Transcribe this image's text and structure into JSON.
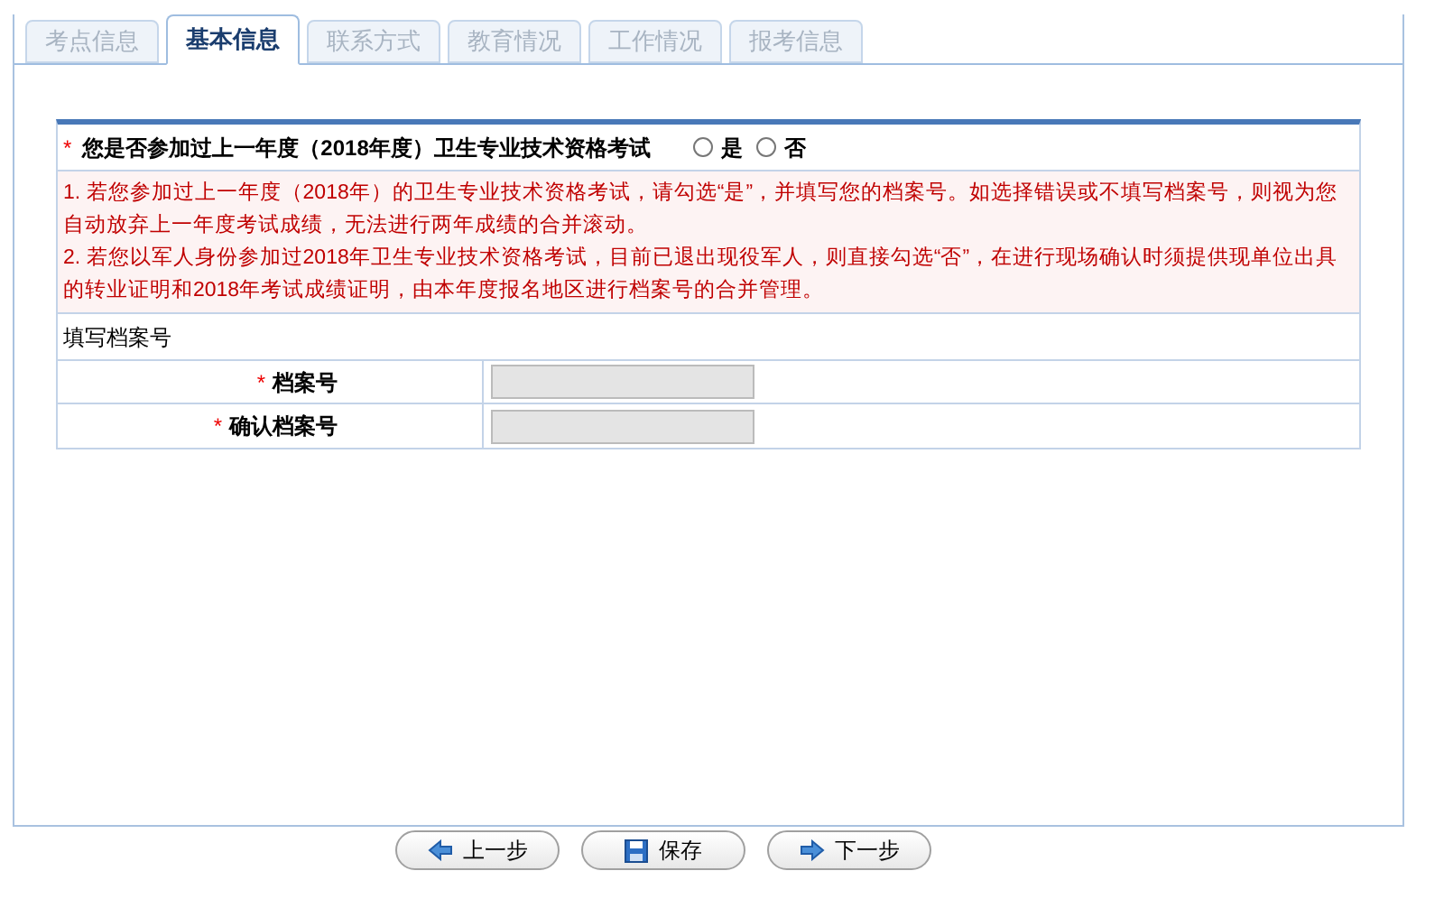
{
  "tabs": [
    {
      "label": "考点信息",
      "selected": false
    },
    {
      "label": "基本信息",
      "selected": true
    },
    {
      "label": "联系方式",
      "selected": false
    },
    {
      "label": "教育情况",
      "selected": false
    },
    {
      "label": "工作情况",
      "selected": false
    },
    {
      "label": "报考信息",
      "selected": false
    }
  ],
  "question": {
    "required_mark": "*",
    "label": "您是否参加过上一年度（2018年度）卫生专业技术资格考试",
    "options": [
      {
        "label": "是",
        "selected": false
      },
      {
        "label": "否",
        "selected": false
      }
    ]
  },
  "notes": [
    "1. 若您参加过上一年度（2018年）的卫生专业技术资格考试，请勾选“是”，并填写您的档案号。如选择错误或不填写档案号，则视为您自动放弃上一年度考试成绩，无法进行两年成绩的合并滚动。",
    "2. 若您以军人身份参加过2018年卫生专业技术资格考试，目前已退出现役军人，则直接勾选“否”，在进行现场确认时须提供现单位出具的转业证明和2018年考试成绩证明，由本年度报名地区进行档案号的合并管理。"
  ],
  "section_title": "填写档案号",
  "fields": [
    {
      "required_mark": "*",
      "label": "档案号",
      "disabled": true
    },
    {
      "required_mark": "*",
      "label": "确认档案号",
      "disabled": true
    }
  ],
  "buttons": [
    {
      "kind": "prev",
      "label": "上一步"
    },
    {
      "kind": "save",
      "label": "保存"
    },
    {
      "kind": "next",
      "label": "下一步"
    }
  ]
}
